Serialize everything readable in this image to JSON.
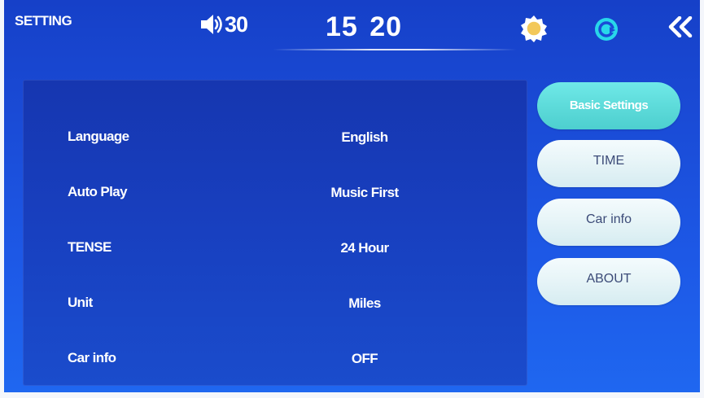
{
  "status_bar": {
    "title": "SETTING",
    "volume": "30",
    "time": "15 20",
    "icons": {
      "volume": "speaker-icon",
      "brightness": "sun-icon",
      "display_mode": "circle-arrow-icon",
      "back": "double-chevron-left-icon"
    }
  },
  "settings": {
    "rows": [
      {
        "label": "Language",
        "value": "English"
      },
      {
        "label": "Auto Play",
        "value": "Music First"
      },
      {
        "label": "TENSE",
        "value": "24 Hour"
      },
      {
        "label": "Unit",
        "value": "Miles"
      },
      {
        "label": "Car info",
        "value": "OFF"
      }
    ]
  },
  "menu": {
    "items": [
      {
        "label": "Basic Settings",
        "active": true
      },
      {
        "label": "TIME",
        "active": false
      },
      {
        "label": "Car info",
        "active": false
      },
      {
        "label": "ABOUT",
        "active": false
      }
    ]
  },
  "colors": {
    "background": "#1a4bd6",
    "panel": "#1840c0",
    "active_button": "#5cdad9",
    "inactive_button": "#e6f4f7",
    "accent_icon": "#28d7ea"
  }
}
